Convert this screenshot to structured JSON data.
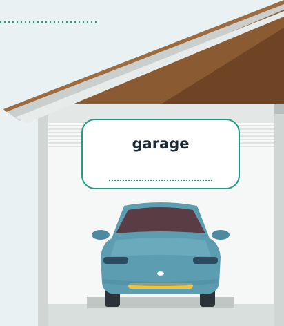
{
  "word": {
    "text": "garage",
    "accent_color": "#1f9e82"
  },
  "scene": {
    "background_color": "#e9f1f2",
    "roof_color": "#8a5a32",
    "wall_color": "#e3e8e6",
    "car_color": "#5d9db1",
    "windshield_color": "#5a3c45"
  },
  "icons": [
    "garage-illustration",
    "car-icon",
    "roof-icon"
  ]
}
